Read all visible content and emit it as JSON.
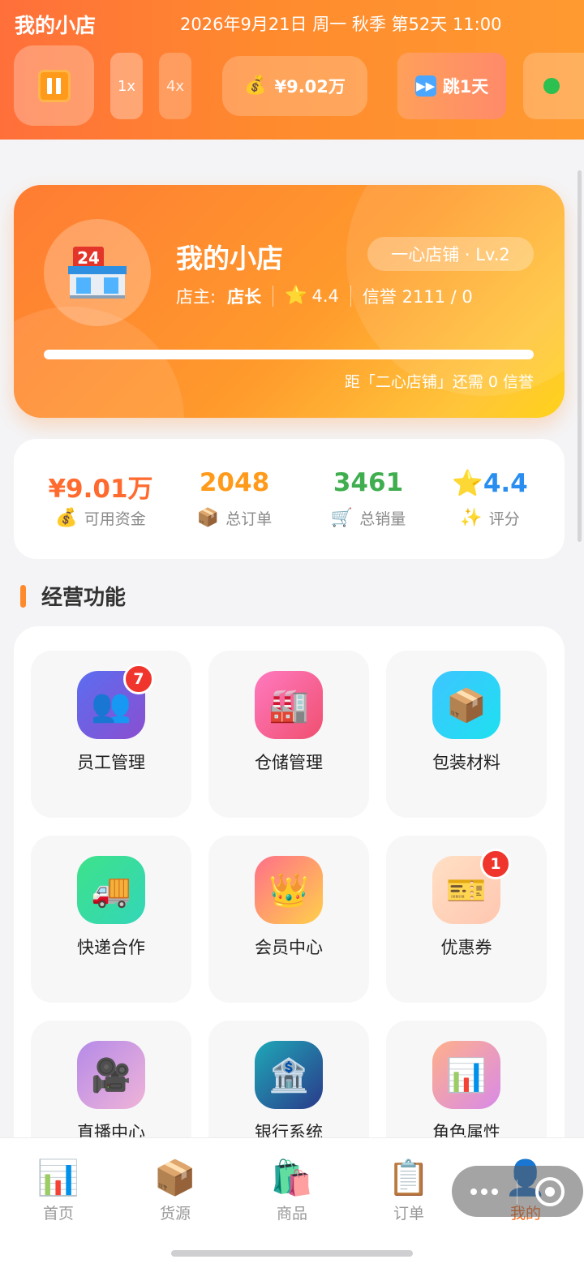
{
  "header": {
    "app_title": "我的小店",
    "datetime": "2026年9月21日 周一 秋季 第52天 11:00",
    "pause_icon": "pause-icon",
    "speed_1x": "1x",
    "speed_4x": "4x",
    "money_icon": "💰",
    "money": "¥9.02万",
    "skip_icon": "⏩",
    "skip_label": "跳1天",
    "status_color": "#2bc04f"
  },
  "shop": {
    "name": "我的小店",
    "level": "一心店铺 · Lv.2",
    "owner_prefix": "店主:",
    "owner_name": "店长",
    "rating_icon": "⭐",
    "rating": "4.4",
    "reputation": "信誉 2111 / 0",
    "progress": 1.0,
    "progress_text": "距「二心店铺」还需 0 信誉"
  },
  "stats": [
    {
      "value": "¥9.01万",
      "icon": "💰",
      "label": "可用资金",
      "color": "#ff6a2e"
    },
    {
      "value": "2048",
      "icon": "📦",
      "label": "总订单",
      "color": "#ff9a1a"
    },
    {
      "value": "3461",
      "icon": "🛒",
      "label": "总销量",
      "color": "#3fae4f"
    },
    {
      "value": "⭐4.4",
      "icon": "✨",
      "label": "评分",
      "color": "#2a8ef0"
    }
  ],
  "section": {
    "title": "经营功能"
  },
  "features": [
    {
      "label": "员工管理",
      "icon": "👥",
      "badge": "7"
    },
    {
      "label": "仓储管理",
      "icon": "🏭",
      "badge": ""
    },
    {
      "label": "包装材料",
      "icon": "📦",
      "badge": ""
    },
    {
      "label": "快递合作",
      "icon": "🚚",
      "badge": ""
    },
    {
      "label": "会员中心",
      "icon": "👑",
      "badge": ""
    },
    {
      "label": "优惠券",
      "icon": "🎫",
      "badge": "1"
    },
    {
      "label": "直播中心",
      "icon": "🎥",
      "badge": ""
    },
    {
      "label": "银行系统",
      "icon": "🏦",
      "badge": ""
    },
    {
      "label": "角色属性",
      "icon": "📊",
      "badge": ""
    }
  ],
  "nav": [
    {
      "label": "首页",
      "icon": "📊",
      "active": false
    },
    {
      "label": "货源",
      "icon": "📦",
      "active": false
    },
    {
      "label": "商品",
      "icon": "🛍️",
      "active": false
    },
    {
      "label": "订单",
      "icon": "📋",
      "active": false
    },
    {
      "label": "我的",
      "icon": "👤",
      "active": true
    }
  ]
}
